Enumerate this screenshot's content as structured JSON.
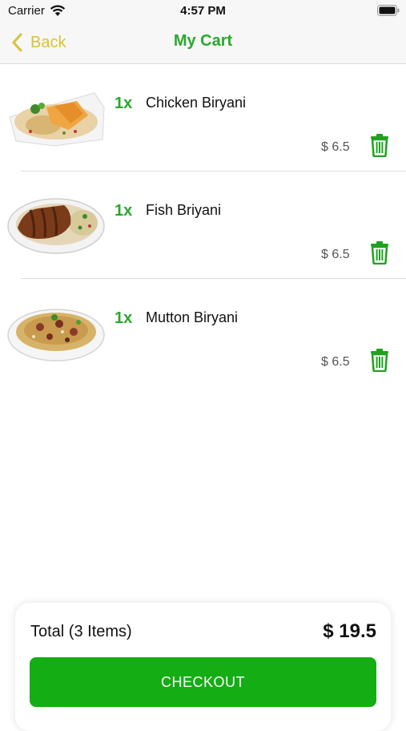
{
  "status_bar": {
    "carrier": "Carrier",
    "time": "4:57 PM",
    "icons": [
      "wifi-icon",
      "battery-icon"
    ]
  },
  "nav": {
    "back_label": "Back",
    "title": "My Cart",
    "back_icon": "chevron-left-icon"
  },
  "colors": {
    "accent_green": "#29a82d",
    "back_yellow": "#d8c236",
    "checkout_green": "#14ad14",
    "trash_green": "#1fa31f"
  },
  "cart": {
    "items": [
      {
        "quantity": "1x",
        "name": "Chicken Biryani",
        "price": "$ 6.5",
        "image_icon": "chicken-biryani-image",
        "delete_icon": "trash-icon"
      },
      {
        "quantity": "1x",
        "name": "Fish Briyani",
        "price": "$ 6.5",
        "image_icon": "fish-briyani-image",
        "delete_icon": "trash-icon"
      },
      {
        "quantity": "1x",
        "name": "Mutton Biryani",
        "price": "$ 6.5",
        "image_icon": "mutton-biryani-image",
        "delete_icon": "trash-icon"
      }
    ]
  },
  "footer": {
    "total_label": "Total (3 Items)",
    "total_value": "$ 19.5",
    "checkout_label": "CHECKOUT"
  }
}
